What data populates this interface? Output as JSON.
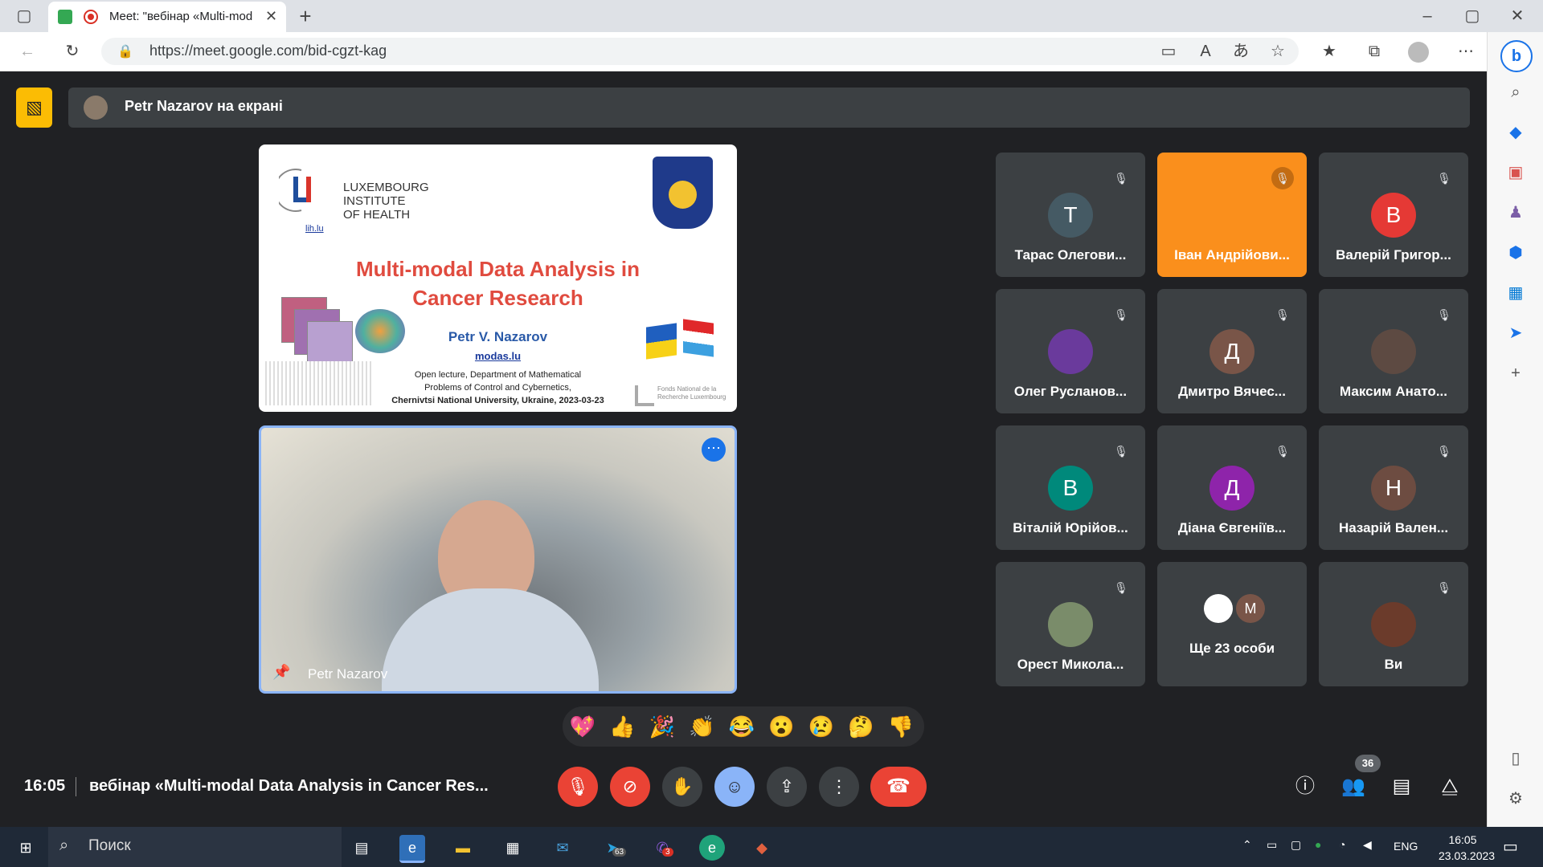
{
  "browser": {
    "tab_title": "Meet: \"вебінар «Multi-mod",
    "url": "https://meet.google.com/bid-cgzt-kag"
  },
  "meet": {
    "presenting_text": "Petr Nazarov на екрані",
    "speaker_name": "Petr Nazarov",
    "slide": {
      "org_line1": "LUXEMBOURG",
      "org_line2": "INSTITUTE",
      "org_line3": "OF HEALTH",
      "org_link": "lih.lu",
      "title_line1": "Multi-modal Data Analysis in",
      "title_line2": "Cancer Research",
      "author": "Petr V. Nazarov",
      "author_link": "modas.lu",
      "lecture_line1": "Open lecture, Department of Mathematical",
      "lecture_line2": "Problems of Control and Cybernetics,",
      "lecture_line3": "Chernivtsi National University, Ukraine, 2023-03-23",
      "fund_line1": "Fonds National de la",
      "fund_line2": "Recherche Luxembourg"
    },
    "participants": [
      {
        "initial": "Т",
        "name": "Тарас Олегови...",
        "color": "#455a64"
      },
      {
        "initial": "",
        "name": "Іван Андрійови...",
        "color": "#fa8f1c"
      },
      {
        "initial": "В",
        "name": "Валерій Григор...",
        "color": "#e53935"
      },
      {
        "initial": "",
        "name": "Олег Русланов...",
        "color": "#6a3a9c"
      },
      {
        "initial": "Д",
        "name": "Дмитро Вячес...",
        "color": "#795548"
      },
      {
        "initial": "",
        "name": "Максим Анато...",
        "color": "#5d4a42"
      },
      {
        "initial": "В",
        "name": "Віталій Юрійов...",
        "color": "#00897b"
      },
      {
        "initial": "Д",
        "name": "Діана Євгеніїв...",
        "color": "#8e24aa"
      },
      {
        "initial": "Н",
        "name": "Назарій Вален...",
        "color": "#6d4c41"
      },
      {
        "initial": "",
        "name": "Орест Микола...",
        "color": "#7a8c6a"
      },
      {
        "initial": "М",
        "name": "Ще 23 особи",
        "color": "#795548"
      },
      {
        "initial": "",
        "name": "Ви",
        "color": "#6b3b2b"
      }
    ],
    "reactions": [
      "💖",
      "👍",
      "🎉",
      "👏",
      "😂",
      "😮",
      "😢",
      "🤔",
      "👎"
    ],
    "time": "16:05",
    "meeting_title": "вебінар «Multi-modal Data Analysis in Cancer Res...",
    "participant_count": "36"
  },
  "taskbar": {
    "search_placeholder": "Поиск",
    "lang": "ENG",
    "time": "16:05",
    "date": "23.03.2023",
    "telegram_badge": "63",
    "viber_badge": "3"
  }
}
